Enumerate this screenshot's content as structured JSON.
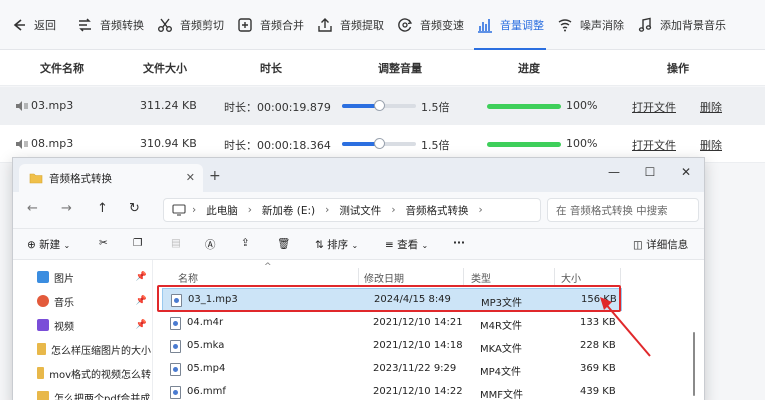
{
  "toolbar": {
    "back": "返回",
    "items": [
      {
        "label": "音频转换",
        "icon": "convert-icon"
      },
      {
        "label": "音频剪切",
        "icon": "scissors-icon"
      },
      {
        "label": "音频合并",
        "icon": "merge-icon"
      },
      {
        "label": "音频提取",
        "icon": "extract-icon"
      },
      {
        "label": "音频变速",
        "icon": "speed-icon"
      },
      {
        "label": "音量调整",
        "icon": "volume-bars-icon",
        "active": true
      },
      {
        "label": "噪声消除",
        "icon": "noise-icon"
      },
      {
        "label": "添加背景音乐",
        "icon": "music-note-icon"
      }
    ]
  },
  "table": {
    "headers": [
      "文件名称",
      "文件大小",
      "时长",
      "调整音量",
      "进度",
      "操作"
    ],
    "rows": [
      {
        "name": "03.mp3",
        "size": "311.24 KB",
        "duration": "时长：00:00:19.879",
        "volume_label": "1.5倍",
        "volume_value": 1.5,
        "progress_label": "100%",
        "progress": 1.0,
        "open": "打开文件",
        "delete": "删除"
      },
      {
        "name": "08.mp3",
        "size": "310.94 KB",
        "duration": "时长：00:00:18.364",
        "volume_label": "1.5倍",
        "volume_value": 1.5,
        "progress_label": "100%",
        "progress": 1.0,
        "open": "打开文件",
        "delete": "删除"
      }
    ]
  },
  "explorer": {
    "tab_title": "音频格式转换",
    "breadcrumb": [
      "此电脑",
      "新加卷 (E:)",
      "测试文件",
      "音频格式转换"
    ],
    "search_placeholder": "在 音频格式转换 中搜索",
    "commands": {
      "new": "新建",
      "sort": "排序",
      "view": "查看",
      "details": "详细信息"
    },
    "sidebar": [
      {
        "label": "图片",
        "color": "#3b8de0"
      },
      {
        "label": "音乐",
        "color": "#e35a3b"
      },
      {
        "label": "视频",
        "color": "#7a4ed8"
      },
      {
        "label": "怎么样压缩图片的大小",
        "color": "#e8b84a"
      },
      {
        "label": "mov格式的视频怎么转",
        "color": "#e8b84a"
      },
      {
        "label": "怎么把两个pdf合并成",
        "color": "#e8b84a"
      }
    ],
    "columns": [
      "名称",
      "修改日期",
      "类型",
      "大小"
    ],
    "files": [
      {
        "name": "03_1.mp3",
        "date": "2024/4/15 8:49",
        "type": "MP3文件",
        "size": "156 KB",
        "selected": true
      },
      {
        "name": "04.m4r",
        "date": "2021/12/10 14:21",
        "type": "M4R文件",
        "size": "133 KB"
      },
      {
        "name": "05.mka",
        "date": "2021/12/10 14:18",
        "type": "MKA文件",
        "size": "228 KB"
      },
      {
        "name": "05.mp4",
        "date": "2023/11/22 9:29",
        "type": "MP4文件",
        "size": "369 KB"
      },
      {
        "name": "06.mmf",
        "date": "2021/12/10 14:22",
        "type": "MMF文件",
        "size": "439 KB"
      }
    ]
  }
}
